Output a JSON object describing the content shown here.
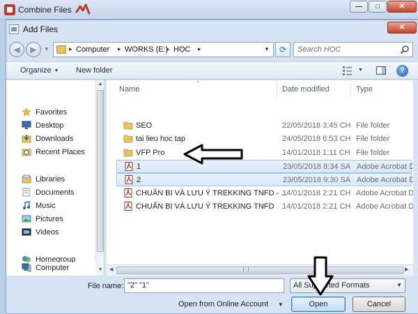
{
  "outer_window": {
    "title": "Combine Files"
  },
  "dialog": {
    "title": "Add Files"
  },
  "address_bar": {
    "crumbs": [
      "Computer",
      "WORKS (E:)",
      "HỌC"
    ],
    "search_placeholder": "Search HỌC"
  },
  "toolbar": {
    "organize_label": "Organize",
    "new_folder_label": "New folder"
  },
  "navigation": {
    "favorites": {
      "label": "Favorites",
      "items": [
        "Desktop",
        "Downloads",
        "Recent Places"
      ]
    },
    "libraries": {
      "label": "Libraries",
      "items": [
        "Documents",
        "Music",
        "Pictures",
        "Videos"
      ]
    },
    "homegroup": "Homegroup",
    "computer": "Computer"
  },
  "file_list": {
    "columns": [
      "Name",
      "Date modified",
      "Type"
    ],
    "rows": [
      {
        "name": "SEO",
        "date": "22/05/2018 3:45 CH",
        "type": "File folder",
        "kind": "folder",
        "selected": false
      },
      {
        "name": "tai lieu hoc tap",
        "date": "24/05/2018 6:53 CH",
        "type": "File folder",
        "kind": "folder",
        "selected": false
      },
      {
        "name": "VFP Pro",
        "date": "14/01/2018 1:11 CH",
        "type": "File folder",
        "kind": "folder",
        "selected": false
      },
      {
        "name": "1",
        "date": "23/05/2018 8:34 SA",
        "type": "Adobe Acrobat D...",
        "kind": "pdf",
        "selected": true
      },
      {
        "name": "2",
        "date": "23/05/2018 9:30 SA",
        "type": "Adobe Acrobat D...",
        "kind": "pdf",
        "selected": true
      },
      {
        "name": "CHUẨN BỊ VÀ LƯU Ý TREKKING TNFD - ...",
        "date": "14/01/2018 2:21 CH",
        "type": "Adobe Acrobat D...",
        "kind": "pdf",
        "selected": false
      },
      {
        "name": "CHUẨN BỊ VÀ LƯU Ý TREKKING TNFD",
        "date": "14/01/2018 2:21 CH",
        "type": "Adobe Acrobat D...",
        "kind": "pdf",
        "selected": false
      }
    ]
  },
  "bottom": {
    "file_name_label": "File name:",
    "file_name_value": "\"2\" \"1\"",
    "filter_value": "All Supported Formats",
    "online_label": "Open from Online Account",
    "open_label": "Open",
    "cancel_label": "Cancel"
  },
  "colors": {
    "selection": "#d7e8fb",
    "selection_border": "#9dc3ee",
    "pdf_red": "#b5281f",
    "folder_yellow": "#e7c35f"
  },
  "icons": [
    "folder-icon",
    "pdf-icon",
    "star-icon",
    "desktop-icon",
    "library-icon",
    "homegroup-icon",
    "computer-icon",
    "search-icon",
    "help-icon",
    "refresh-icon"
  ]
}
